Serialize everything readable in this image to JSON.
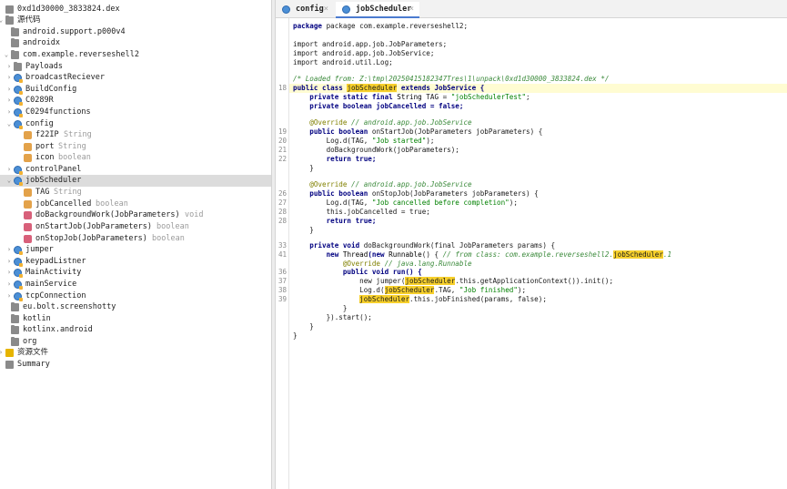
{
  "tree": {
    "rows": [
      {
        "label": "0xd1d30000_3833824.dex",
        "type": "",
        "icon": "dex-file-icon",
        "kind": "sum"
      },
      {
        "label": "源代码",
        "type": "",
        "icon": "source-folder-icon",
        "kind": "folder"
      },
      {
        "label": "android.support.p000v4",
        "type": "",
        "icon": "package-icon",
        "kind": "folder"
      },
      {
        "label": "androidx",
        "type": "",
        "icon": "package-icon",
        "kind": "folder"
      },
      {
        "label": "com.example.reverseshell2",
        "type": "",
        "icon": "package-icon",
        "kind": "folder"
      },
      {
        "label": "Payloads",
        "type": "",
        "icon": "package-icon",
        "kind": "folder"
      },
      {
        "label": "broadcastReciever",
        "type": "",
        "icon": "class-icon",
        "kind": "class"
      },
      {
        "label": "BuildConfig",
        "type": "",
        "icon": "class-icon",
        "kind": "class"
      },
      {
        "label": "C0289R",
        "type": "",
        "icon": "class-icon",
        "kind": "class"
      },
      {
        "label": "C0294functions",
        "type": "",
        "icon": "class-icon",
        "kind": "class"
      },
      {
        "label": "config",
        "type": "",
        "icon": "class-icon",
        "kind": "class"
      },
      {
        "label": "f22IP",
        "type": "String",
        "icon": "field-icon",
        "kind": "field"
      },
      {
        "label": "port",
        "type": "String",
        "icon": "field-icon",
        "kind": "field"
      },
      {
        "label": "icon",
        "type": "boolean",
        "icon": "field-icon",
        "kind": "field"
      },
      {
        "label": "controlPanel",
        "type": "",
        "icon": "class-icon",
        "kind": "class"
      },
      {
        "label": "jobScheduler",
        "type": "",
        "icon": "class-icon",
        "kind": "class"
      },
      {
        "label": "TAG",
        "type": "String",
        "icon": "field-icon",
        "kind": "field"
      },
      {
        "label": "jobCancelled",
        "type": "boolean",
        "icon": "field-icon",
        "kind": "field"
      },
      {
        "label": "doBackgroundWork(JobParameters)",
        "type": "void",
        "icon": "method-icon",
        "kind": "method"
      },
      {
        "label": "onStartJob(JobParameters)",
        "type": "boolean",
        "icon": "method-icon",
        "kind": "method"
      },
      {
        "label": "onStopJob(JobParameters)",
        "type": "boolean",
        "icon": "method-icon",
        "kind": "method"
      },
      {
        "label": "jumper",
        "type": "",
        "icon": "class-icon",
        "kind": "class"
      },
      {
        "label": "keypadListner",
        "type": "",
        "icon": "class-icon",
        "kind": "class"
      },
      {
        "label": "MainActivity",
        "type": "",
        "icon": "class-icon",
        "kind": "class"
      },
      {
        "label": "mainService",
        "type": "",
        "icon": "class-icon",
        "kind": "class"
      },
      {
        "label": "tcpConnection",
        "type": "",
        "icon": "class-icon",
        "kind": "class"
      },
      {
        "label": "eu.bolt.screenshotty",
        "type": "",
        "icon": "package-icon",
        "kind": "folder"
      },
      {
        "label": "kotlin",
        "type": "",
        "icon": "package-icon",
        "kind": "folder"
      },
      {
        "label": "kotlinx.android",
        "type": "",
        "icon": "package-icon",
        "kind": "folder"
      },
      {
        "label": "org",
        "type": "",
        "icon": "package-icon",
        "kind": "folder"
      },
      {
        "label": "资源文件",
        "type": "",
        "icon": "resources-icon",
        "kind": "res"
      },
      {
        "label": "Summary",
        "type": "",
        "icon": "summary-icon",
        "kind": "sum"
      }
    ]
  },
  "tabs": [
    {
      "label": "config",
      "close": "×"
    },
    {
      "label": "jobScheduler",
      "close": "×"
    }
  ],
  "code": {
    "line_numbers": [
      "18",
      "19",
      "20",
      "21",
      "22",
      "26",
      "27",
      "28",
      "28",
      "33",
      "41",
      "36",
      "37",
      "38",
      "39"
    ],
    "l_package": "package com.example.reverseshell2;",
    "l_imp1": "import android.app.job.JobParameters;",
    "l_imp2": "import android.app.job.JobService;",
    "l_imp3": "import android.util.Log;",
    "l_loaded": "/* Loaded from: Z:\\tmp\\20250415182347Tres\\1\\unpack\\0xd1d30000_3833824.dex */",
    "l_class_a": "public class ",
    "l_class_name": "jobScheduler",
    "l_class_b": " extends JobService {",
    "l_tag_a": "    private static final ",
    "l_tag_type": "String",
    "l_tag_b": " TAG = ",
    "l_tag_str": "\"jobSchedulerTest\"",
    "l_tag_c": ";",
    "l_cancel": "    private boolean jobCancelled = false;",
    "l_ann1_a": "    @Override",
    "l_ann1_b": " // android.app.job.JobService",
    "l_start_a": "    public boolean",
    "l_start_b": " onStartJob(JobParameters jobParameters) {",
    "l_logd1_a": "        Log.d(TAG, ",
    "l_logd1_s": "\"Job started\"",
    "l_logd1_b": ");",
    "l_dobg": "        doBackgroundWork(jobParameters);",
    "l_rettrue": "        return true;",
    "l_close4": "    }",
    "l_ann2_a": "    @Override",
    "l_ann2_b": " // android.app.job.JobService",
    "l_stop_a": "    public boolean",
    "l_stop_b": " onStopJob(JobParameters jobParameters) {",
    "l_logd2_a": "        Log.d(TAG, ",
    "l_logd2_s": "\"Job cancelled before completion\"",
    "l_logd2_b": ");",
    "l_thiscancel": "        this.jobCancelled = true;",
    "l_rettrue2": "        return true;",
    "l_close4b": "    }",
    "l_pv_a": "    private void",
    "l_pv_b": " doBackgroundWork(final JobParameters params) {",
    "l_new_a": "        new ",
    "l_new_thread": "Thread",
    "l_new_b": "(new ",
    "l_new_runnable": "Runnable",
    "l_new_c": "() { ",
    "l_new_cm": "// from class: com.example.reverseshell2.",
    "l_new_hl": "jobScheduler",
    "l_new_cm2": ".1",
    "l_ann3_a": "            @Override",
    "l_ann3_b": " // java.lang.Runnable",
    "l_run": "            public void run() {",
    "l_jump_a": "                new jumper(",
    "l_jump_hl": "jobScheduler",
    "l_jump_b": ".this.getApplicationContext()).init();",
    "l_logd3_a": "                Log.d(",
    "l_logd3_hl": "jobScheduler",
    "l_logd3_b": ".TAG, ",
    "l_logd3_s": "\"Job finished\"",
    "l_logd3_c": ");",
    "l_fin_hl": "jobScheduler",
    "l_fin_b": ".this.jobFinished(params, false);",
    "l_close12": "            }",
    "l_start_end": "        }).start();",
    "l_close4c": "    }",
    "l_close0": "}"
  }
}
